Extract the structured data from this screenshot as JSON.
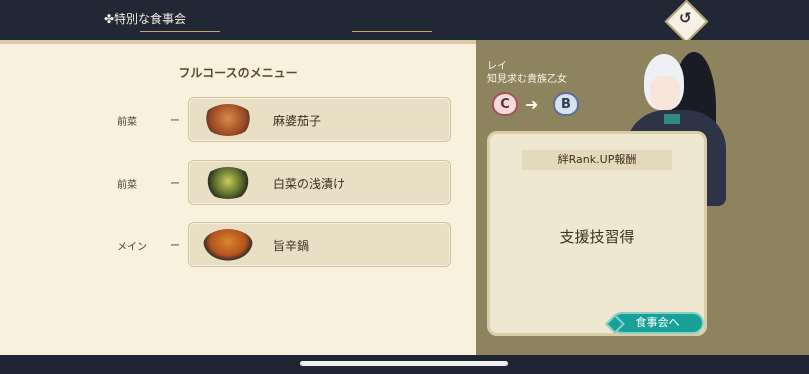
{
  "header": {
    "title": "✤特別な食事会",
    "back_icon": "back-arrow-icon"
  },
  "menu": {
    "title": "フルコースのメニュー",
    "courses": [
      {
        "label": "前菜",
        "dash": "ー",
        "dish": "麻婆茄子",
        "icon": "mabo-eggplant-dish-icon"
      },
      {
        "label": "前菜",
        "dash": "ー",
        "dish": "白菜の浅漬け",
        "icon": "pickled-cabbage-dish-icon"
      },
      {
        "label": "メイン",
        "dash": "ー",
        "dish": "旨辛鍋",
        "icon": "spicy-hotpot-icon"
      }
    ]
  },
  "character": {
    "name": "レイ",
    "title": "知見求む貴族乙女",
    "rank_from": "C",
    "rank_to": "B"
  },
  "reward": {
    "header": "絆Rank.UP報酬",
    "text": "支援技習得",
    "button": "食事会へ"
  },
  "colors": {
    "accent": "#19a199",
    "panel": "#f7f1dd",
    "right_bg": "#8e835f"
  }
}
